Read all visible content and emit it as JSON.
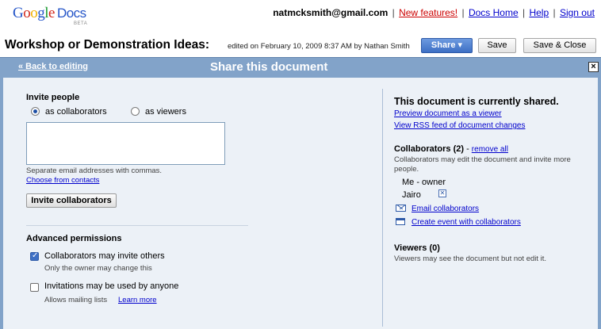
{
  "header": {
    "logo_text": "Google Docs",
    "logo_beta": "BETA",
    "user_email": "natmcksmith@gmail.com",
    "links": [
      "New features!",
      "Docs Home",
      "Help",
      "Sign out"
    ],
    "separator": "|"
  },
  "document": {
    "title": "Workshop or Demonstration Ideas:",
    "edit_info": "edited on February 10, 2009 8:37 AM by Nathan Smith"
  },
  "toolbar": {
    "share_label": "Share ▾",
    "save_label": "Save",
    "save_close_label": "Save & Close"
  },
  "dialog": {
    "back_label": "« Back to editing",
    "title": "Share this document",
    "close_label": "×"
  },
  "invite": {
    "heading": "Invite people",
    "option_collaborators": "as collaborators",
    "option_viewers": "as viewers",
    "selected_option": "as collaborators",
    "textarea_value": "",
    "hint": "Separate email addresses with commas.",
    "choose_contacts": "Choose from contacts",
    "invite_button": "Invite collaborators"
  },
  "advanced": {
    "heading": "Advanced permissions",
    "items": [
      {
        "label": "Collaborators may invite others",
        "checked": true,
        "sublabel": "Only the owner may change this",
        "link": ""
      },
      {
        "label": "Invitations may be used by anyone",
        "checked": false,
        "sublabel": "Allows mailing lists",
        "link": "Learn more"
      }
    ]
  },
  "sharing": {
    "heading": "This document is currently shared.",
    "preview_link": "Preview document as a viewer",
    "rss_link": "View RSS feed of document changes",
    "collaborators_heading": "Collaborators (2)",
    "collaborators_dash": " - ",
    "remove_all": "remove all",
    "collaborators_desc_line1": "Collaborators may edit the document and invite more",
    "collaborators_desc_line2": "people.",
    "collaborators": [
      "Me - owner",
      "Jairo"
    ],
    "email_collaborators": "Email collaborators",
    "create_event": "Create event with collaborators",
    "viewers_heading": "Viewers (0)",
    "viewers_desc": "Viewers may see the document but not edit it."
  },
  "colors": {
    "dialog_header": "#82a3c9",
    "dialog_body": "#ecf1f7",
    "link": "#0000cc",
    "share_button": "#3d6fc4"
  }
}
